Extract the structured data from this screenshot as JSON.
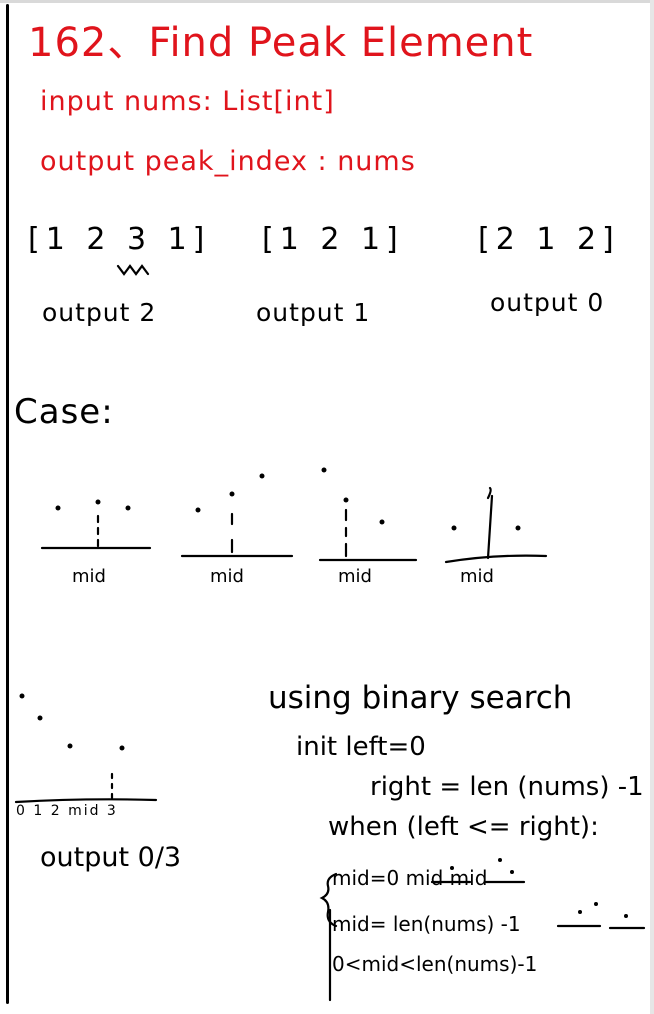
{
  "title": "162、Find Peak Element",
  "input_line": "input  nums: List[int]",
  "output_line": "output  peak_index : nums",
  "examples": [
    {
      "array": "[1 2 3 1]",
      "output": "output 2"
    },
    {
      "array": "[1 2 1]",
      "output": "output 1"
    },
    {
      "array": "[2 1 2]",
      "output": "output 0"
    }
  ],
  "case_heading": "Case:",
  "cases": [
    "mid",
    "mid",
    "mid",
    "mid"
  ],
  "edge_example": {
    "axis_labels": "0 1 2 mid 3",
    "output": "output 0/3"
  },
  "approach": {
    "heading": "using binary search",
    "init_left": "init left=0",
    "init_right": "right = len (nums) -1",
    "loop": "when (left <= right):",
    "branches": [
      "mid=0   mid   mid",
      "mid= len(nums) -1",
      "0<mid<len(nums)-1"
    ]
  }
}
